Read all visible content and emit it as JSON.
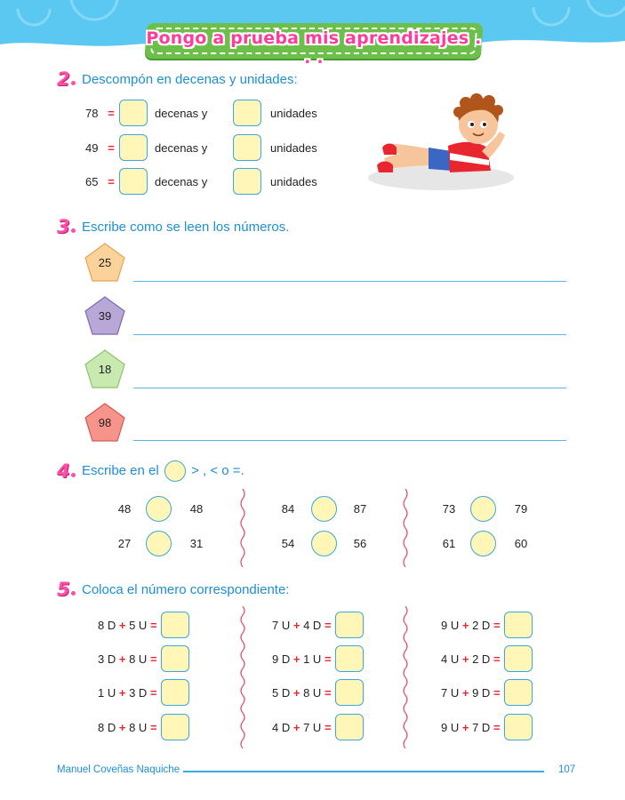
{
  "title": "Pongo a prueba mis aprendizajes . . .",
  "section2": {
    "number": "2",
    "instruction": "Descompón en decenas y unidades:",
    "rows": [
      {
        "number": "78",
        "eq": "=",
        "tens_label": "decenas y",
        "units_label": "unidades"
      },
      {
        "number": "49",
        "eq": "=",
        "tens_label": "decenas y",
        "units_label": "unidades"
      },
      {
        "number": "65",
        "eq": "=",
        "tens_label": "decenas y",
        "units_label": "unidades"
      }
    ]
  },
  "section3": {
    "number": "3",
    "instruction": "Escribe como se leen los números.",
    "items": [
      {
        "value": "25",
        "color": "#fbd39a"
      },
      {
        "value": "39",
        "color": "#b9a7d8"
      },
      {
        "value": "18",
        "color": "#c8eab0"
      },
      {
        "value": "98",
        "color": "#f6938b"
      }
    ]
  },
  "section4": {
    "number": "4",
    "instruction_before": "Escribe en el",
    "instruction_after": "> , < o =.",
    "columns": [
      [
        {
          "left": "48",
          "right": "48"
        },
        {
          "left": "27",
          "right": "31"
        }
      ],
      [
        {
          "left": "84",
          "right": "87"
        },
        {
          "left": "54",
          "right": "56"
        }
      ],
      [
        {
          "left": "73",
          "right": "79"
        },
        {
          "left": "61",
          "right": "60"
        }
      ]
    ]
  },
  "section5": {
    "number": "5",
    "instruction": "Coloca el número correspondiente:",
    "columns": [
      [
        {
          "a": "8 D",
          "b": "5 U"
        },
        {
          "a": "3 D",
          "b": "8 U"
        },
        {
          "a": "1 U",
          "b": "3 D"
        },
        {
          "a": "8 D",
          "b": "8 U"
        }
      ],
      [
        {
          "a": "7 U",
          "b": "4 D"
        },
        {
          "a": "9 D",
          "b": "1 U"
        },
        {
          "a": "5 D",
          "b": "8 U"
        },
        {
          "a": "4 D",
          "b": "7 U"
        }
      ],
      [
        {
          "a": "9 U",
          "b": "2 D"
        },
        {
          "a": "4 U",
          "b": "2 D"
        },
        {
          "a": "7 U",
          "b": "9 D"
        },
        {
          "a": "9 U",
          "b": "7 D"
        }
      ]
    ],
    "plus": "+",
    "equals": "="
  },
  "footer": {
    "author": "Manuel Coveñas Naquiche",
    "page": "107"
  },
  "colors": {
    "accent_blue": "#1e8fd0",
    "pink": "#ff4fa6",
    "banner_green": "#6cc04a",
    "box_fill": "#fff6b8",
    "sky": "#5bc8f2"
  }
}
